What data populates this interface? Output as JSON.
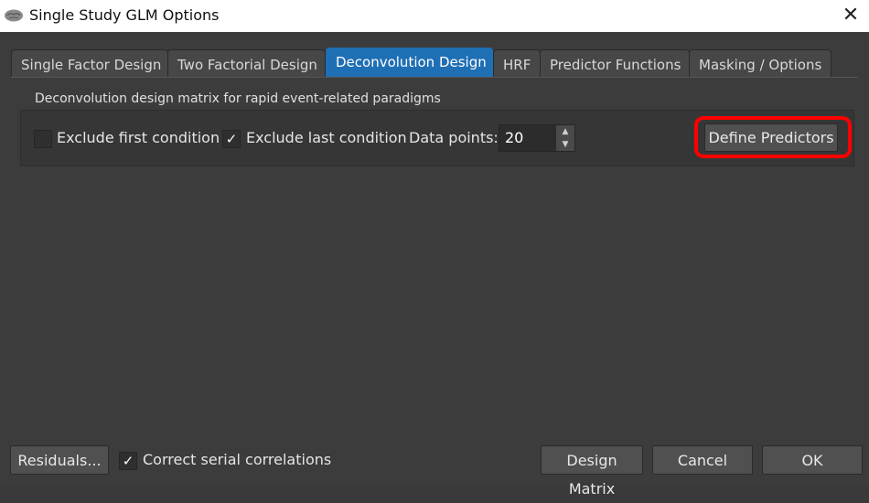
{
  "window": {
    "title": "Single Study GLM Options",
    "close_glyph": "✕"
  },
  "tabs": [
    {
      "label": "Single Factor Design"
    },
    {
      "label": "Two Factorial Design"
    },
    {
      "label": "Deconvolution Design"
    },
    {
      "label": "HRF"
    },
    {
      "label": "Predictor Functions"
    },
    {
      "label": "Masking / Options"
    }
  ],
  "active_tab": "Deconvolution Design",
  "deconvolution": {
    "description": "Deconvolution design matrix for rapid event-related paradigms",
    "exclude_first": {
      "label": "Exclude first condition",
      "checked": false
    },
    "exclude_last": {
      "label": "Exclude last condition",
      "checked": true,
      "check_glyph": "✓"
    },
    "data_points": {
      "label": "Data points:",
      "value": "20"
    },
    "define_predictors_label": "Define Predictors"
  },
  "footer": {
    "residuals_label": "Residuals...",
    "correct_serial": {
      "label": "Correct serial correlations",
      "checked": true,
      "check_glyph": "✓"
    },
    "design_matrix_label": "Design Matrix",
    "cancel_label": "Cancel",
    "ok_label": "OK"
  },
  "annotation_color": "#ff0000",
  "accent_color": "#1f6fb5"
}
